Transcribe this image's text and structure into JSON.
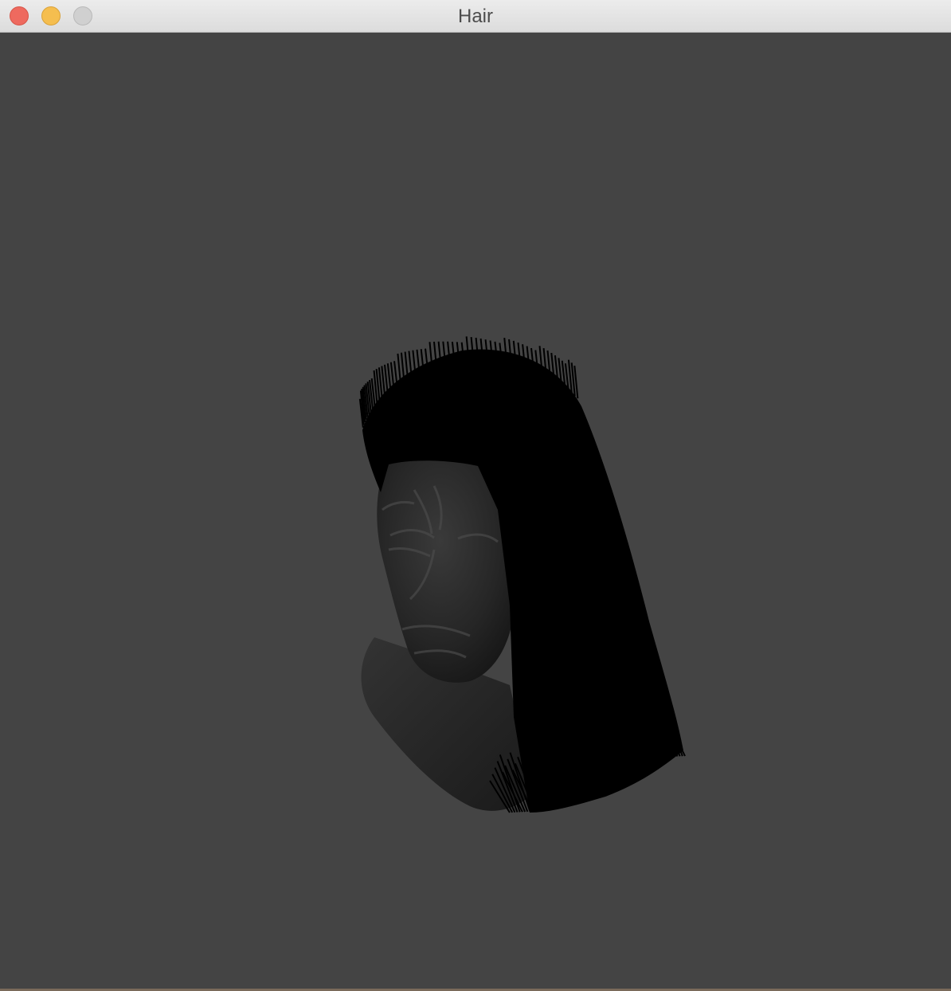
{
  "window": {
    "title": "Hair"
  },
  "colors": {
    "background": "#444444",
    "titlebar": "#e3e3e3",
    "close": "#ee6a5f",
    "minimize": "#f5be4f",
    "zoom": "#d0d0d0"
  },
  "icons": {
    "close": "close-button",
    "minimize": "minimize-button",
    "zoom": "zoom-button"
  }
}
